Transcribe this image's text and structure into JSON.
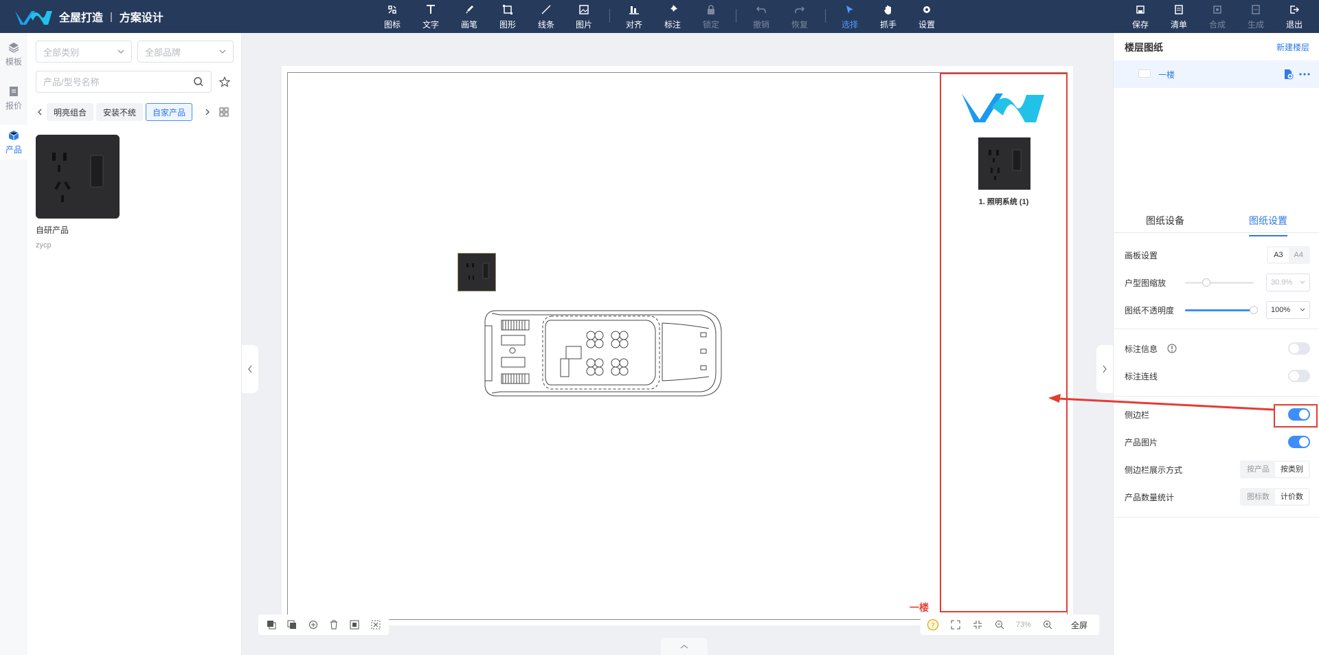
{
  "app": {
    "brand_name": "全屋打造",
    "brand_separator": "|",
    "brand_sub": "方案设计"
  },
  "toolbar": {
    "tools": [
      {
        "label": "图标",
        "icon": "icon-stamp-icon"
      },
      {
        "label": "文字",
        "icon": "text-icon"
      },
      {
        "label": "画笔",
        "icon": "brush-icon"
      },
      {
        "label": "图形",
        "icon": "shape-icon"
      },
      {
        "label": "线条",
        "icon": "line-icon"
      },
      {
        "label": "图片",
        "icon": "image-icon"
      },
      {
        "label": "对齐",
        "icon": "align-icon"
      },
      {
        "label": "标注",
        "icon": "pin-icon"
      },
      {
        "label": "锁定",
        "icon": "lock-icon"
      },
      {
        "label": "撤销",
        "icon": "undo-icon"
      },
      {
        "label": "恢复",
        "icon": "redo-icon"
      },
      {
        "label": "选择",
        "icon": "cursor-icon"
      },
      {
        "label": "抓手",
        "icon": "hand-icon"
      },
      {
        "label": "设置",
        "icon": "gear-icon"
      }
    ],
    "right_actions": [
      {
        "label": "保存",
        "icon": "save-icon"
      },
      {
        "label": "清单",
        "icon": "list-icon"
      },
      {
        "label": "合成",
        "icon": "compose-icon"
      },
      {
        "label": "生成",
        "icon": "generate-icon"
      },
      {
        "label": "退出",
        "icon": "exit-icon"
      }
    ]
  },
  "rail": {
    "items": [
      {
        "label": "模板",
        "icon": "layers-icon"
      },
      {
        "label": "报价",
        "icon": "quote-icon"
      },
      {
        "label": "产品",
        "icon": "cube-icon"
      }
    ]
  },
  "product_panel": {
    "category_placeholder": "全部类别",
    "brand_placeholder": "全部品牌",
    "search_placeholder": "产品/型号名称",
    "tags": [
      "明亮组合",
      "安装不统",
      "自家产品"
    ],
    "products": [
      {
        "title": "自研产品",
        "code": "zycp"
      }
    ]
  },
  "canvas": {
    "floor_label": "一楼",
    "legend_item": "1. 照明系统 (1)",
    "zoom": "73%",
    "fullscreen_label": "全屏"
  },
  "right_panel": {
    "title": "楼层图纸",
    "new_floor": "新建楼层",
    "floor_name": "一楼",
    "tabs": [
      "图纸设备",
      "图纸设置"
    ],
    "settings": {
      "board_label": "画板设置",
      "board_options": [
        "A3",
        "A4"
      ],
      "scale_label": "户型图缩放",
      "scale_value": "30.9%",
      "scale_level": 0.309,
      "opacity_label": "图纸不透明度",
      "opacity_value": "100%",
      "opacity_level": 1.0,
      "annot_info_label": "标注信息",
      "annot_line_label": "标注连线",
      "sidebar_label": "侧边栏",
      "product_img_label": "产品图片",
      "sidebar_mode_label": "侧边栏展示方式",
      "sidebar_mode_options": [
        "按产品",
        "按类别"
      ],
      "count_label": "产品数量统计",
      "count_options": [
        "图标数",
        "计价数"
      ]
    }
  },
  "colors": {
    "topbar": "#263a5c",
    "accent": "#2f7ae5",
    "highlight": "#e33c33"
  }
}
